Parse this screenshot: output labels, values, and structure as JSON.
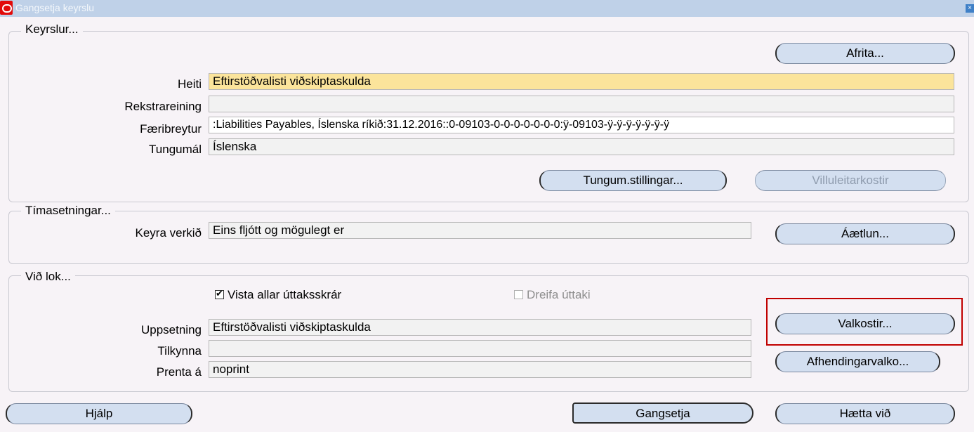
{
  "window": {
    "title": "Gangsetja keyrslu"
  },
  "groups": {
    "keyrslur": {
      "legend": "Keyrslur...",
      "copy_button": "Afrita...",
      "fields": {
        "heiti": {
          "label": "Heiti",
          "value": "Eftirstöðvalisti viðskiptaskulda"
        },
        "rekstrareining": {
          "label": "Rekstrareining",
          "value": ""
        },
        "faeribreytur": {
          "label": "Færibreytur",
          "value": ":Liabilities Payables, Íslenska ríkið:31.12.2016::0-09103-0-0-0-0-0-0-0:ÿ-09103-ÿ-ÿ-ÿ-ÿ-ÿ-ÿ-ÿ"
        },
        "tungumal": {
          "label": "Tungumál",
          "value": "Íslenska"
        }
      },
      "lang_settings_button": "Tungum.stillingar...",
      "debug_button": "Villuleitarkostir"
    },
    "timasetningar": {
      "legend": "Tímasetningar...",
      "run_label": "Keyra verkið",
      "run_value": "Eins fljótt og mögulegt er",
      "schedule_button": "Áætlun..."
    },
    "vid_lok": {
      "legend": "Við lok...",
      "save_all_label": "Vista allar úttaksskrár",
      "save_all_checked": true,
      "distribute_label": "Dreifa úttaki",
      "distribute_checked": false,
      "uppsetning": {
        "label": "Uppsetning",
        "value": "Eftirstöðvalisti viðskiptaskulda"
      },
      "tilkynna": {
        "label": "Tilkynna",
        "value": ""
      },
      "prenta": {
        "label": "Prenta á",
        "value": "noprint"
      },
      "options_button": "Valkostir...",
      "delivery_button": "Afhendingarvalko..."
    }
  },
  "footer": {
    "help_button": "Hjálp",
    "submit_button": "Gangsetja",
    "cancel_button": "Hætta við"
  },
  "colors": {
    "title_bar": "#bfd1e8",
    "button_fill": "#d3dff0",
    "required_field": "#fbe49b",
    "highlight_box": "#c00000"
  }
}
